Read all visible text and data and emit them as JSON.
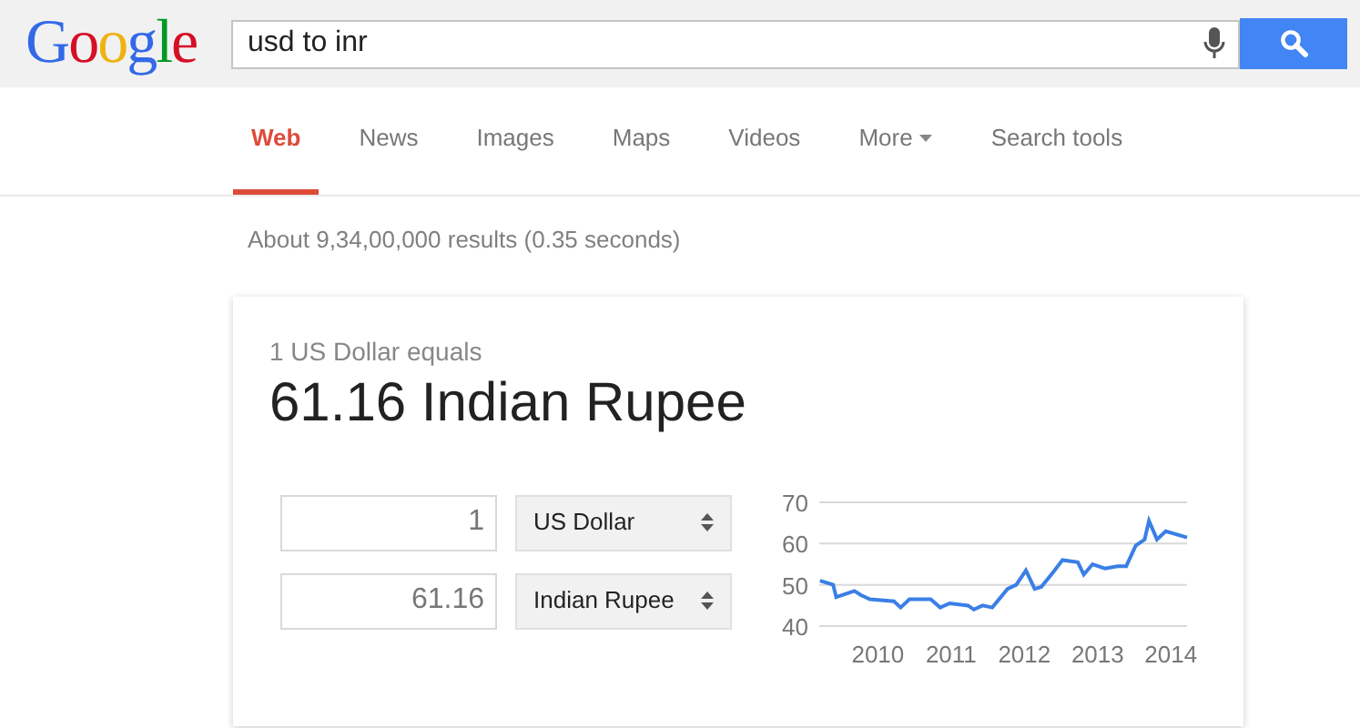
{
  "header": {
    "logo": "Google",
    "search": {
      "value": "usd to inr"
    }
  },
  "tabs": [
    {
      "label": "Web",
      "selected": true,
      "kind": "tab"
    },
    {
      "label": "News",
      "selected": false,
      "kind": "tab"
    },
    {
      "label": "Images",
      "selected": false,
      "kind": "tab"
    },
    {
      "label": "Maps",
      "selected": false,
      "kind": "tab"
    },
    {
      "label": "Videos",
      "selected": false,
      "kind": "tab"
    },
    {
      "label": "More",
      "selected": false,
      "kind": "menu"
    },
    {
      "label": "Search tools",
      "selected": false,
      "kind": "tab"
    }
  ],
  "results_count": "About 9,34,00,000 results (0.35 seconds)",
  "converter": {
    "subtitle": "1 US Dollar equals",
    "result": "61.16 Indian Rupee",
    "rows": [
      {
        "amount": "1",
        "currency": "US Dollar"
      },
      {
        "amount": "61.16",
        "currency": "Indian Rupee"
      }
    ],
    "chart_data": {
      "type": "line",
      "grid": true,
      "ylim": [
        40,
        70
      ],
      "xlim": [
        2009.2,
        2014.22
      ],
      "yticks": [
        40,
        50,
        60,
        70
      ],
      "xticks": [
        2010,
        2011,
        2012,
        2013,
        2014
      ],
      "x": [
        2009.21,
        2009.39,
        2009.43,
        2009.68,
        2009.77,
        2009.89,
        2010.22,
        2010.31,
        2010.43,
        2010.72,
        2010.85,
        2010.98,
        2011.23,
        2011.31,
        2011.43,
        2011.56,
        2011.77,
        2011.89,
        2012.02,
        2012.14,
        2012.23,
        2012.39,
        2012.52,
        2012.73,
        2012.81,
        2012.93,
        2013.1,
        2013.27,
        2013.39,
        2013.52,
        2013.64,
        2013.7,
        2013.81,
        2013.93,
        2014.22
      ],
      "series": [
        {
          "color": "#3a7fe6",
          "values": [
            51,
            50,
            47,
            48.5,
            47.5,
            46.5,
            46,
            44.5,
            46.5,
            46.5,
            44.5,
            45.5,
            45,
            44,
            45,
            44.5,
            49,
            50,
            53.5,
            49,
            49.5,
            53,
            56,
            55.5,
            52.5,
            55,
            54,
            54.5,
            54.5,
            59.5,
            61,
            65.5,
            61,
            63,
            61.5
          ]
        }
      ]
    }
  }
}
